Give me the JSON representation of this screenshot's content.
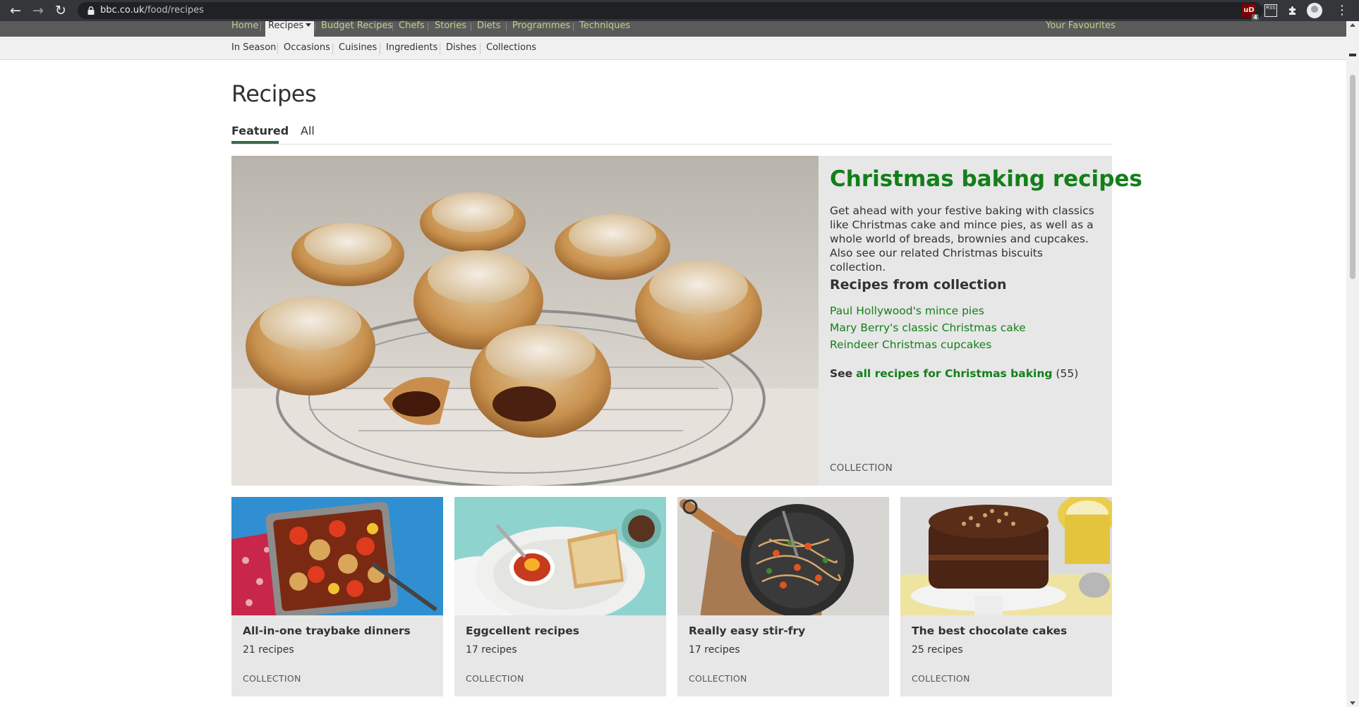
{
  "browser": {
    "url_host": "bbc.co.uk",
    "url_path": "/food/recipes",
    "extension_badge": "4",
    "extension_ublock_label": "uD",
    "extension_rss_label": "RSS"
  },
  "primary_nav": {
    "items": [
      "Home",
      "Recipes",
      "Budget Recipes",
      "Chefs",
      "Stories",
      "Diets",
      "Programmes",
      "Techniques"
    ],
    "active": "Recipes",
    "favourites": "Your Favourites"
  },
  "secondary_nav": {
    "items": [
      "In Season",
      "Occasions",
      "Cuisines",
      "Ingredients",
      "Dishes",
      "Collections"
    ]
  },
  "page": {
    "title": "Recipes",
    "tabs": [
      {
        "label": "Featured",
        "active": true
      },
      {
        "label": "All",
        "active": false
      }
    ]
  },
  "hero": {
    "title": "Christmas baking recipes",
    "description": "Get ahead with your festive baking with classics like Christmas cake and mince pies, as well as a whole world of breads, brownies and cupcakes. Also see our related Christmas biscuits collection.",
    "subheading": "Recipes from collection",
    "links": [
      "Paul Hollywood's mince pies",
      "Mary Berry's classic Christmas cake",
      "Reindeer Christmas cupcakes"
    ],
    "see_all_lead": "See",
    "see_all_link": "all recipes for Christmas baking",
    "see_all_count": "(55)",
    "tag": "COLLECTION"
  },
  "cards": [
    {
      "title": "All-in-one traybake dinners",
      "count": "21 recipes",
      "tag": "COLLECTION"
    },
    {
      "title": "Eggcellent recipes",
      "count": "17 recipes",
      "tag": "COLLECTION"
    },
    {
      "title": "Really easy stir-fry",
      "count": "17 recipes",
      "tag": "COLLECTION"
    },
    {
      "title": "The best chocolate cakes",
      "count": "25 recipes",
      "tag": "COLLECTION"
    }
  ],
  "colors": {
    "brand_green": "#137f19",
    "nav_link": "#bcd38c",
    "nav_bar": "#5a5a5a",
    "panel_bg": "#e7e7e7"
  },
  "icons": [
    "back-icon",
    "forward-icon",
    "reload-icon",
    "lock-icon",
    "star-icon",
    "ublock-icon",
    "rss-icon",
    "puzzle-icon",
    "avatar",
    "kebab-menu-icon"
  ]
}
